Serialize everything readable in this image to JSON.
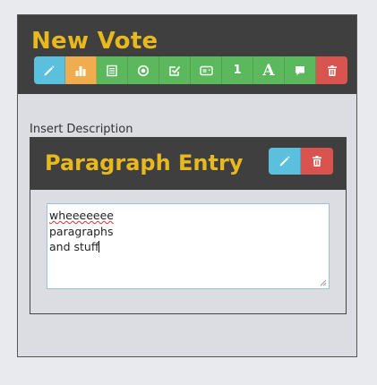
{
  "header": {
    "title": "New Vote"
  },
  "toolbar": {
    "buttons": [
      {
        "name": "edit-button",
        "icon": "pencil-icon",
        "color": "#5bc0de"
      },
      {
        "name": "chart-button",
        "icon": "bar-chart-icon",
        "color": "#f0ad4e"
      },
      {
        "name": "list-button",
        "icon": "list-icon",
        "color": "#5cb85c"
      },
      {
        "name": "radio-button",
        "icon": "radio-circle-icon",
        "color": "#5cb85c"
      },
      {
        "name": "checkbox-button",
        "icon": "checkbox-icon",
        "color": "#5cb85c"
      },
      {
        "name": "dropdown-button",
        "icon": "dropdown-select-icon",
        "color": "#5cb85c"
      },
      {
        "name": "number-button",
        "icon": "number-icon",
        "text": "1",
        "color": "#5cb85c"
      },
      {
        "name": "text-button",
        "icon": "font-icon",
        "text": "A",
        "color": "#5cb85c"
      },
      {
        "name": "comment-button",
        "icon": "speech-bubble-icon",
        "color": "#5cb85c"
      },
      {
        "name": "delete-button",
        "icon": "trash-icon",
        "color": "#d9534f"
      }
    ]
  },
  "description": {
    "label": "Insert Description"
  },
  "entry": {
    "title": "Paragraph Entry",
    "edit_icon": "pencil-icon",
    "delete_icon": "trash-icon",
    "textarea": {
      "lines": [
        "wheeeeeee",
        "paragraphs",
        "and stuff"
      ]
    }
  },
  "colors": {
    "accent": "#e8b91e",
    "header_bg": "#3f3f3f",
    "info": "#5bc0de",
    "warning": "#f0ad4e",
    "success": "#5cb85c",
    "danger": "#d9534f"
  }
}
